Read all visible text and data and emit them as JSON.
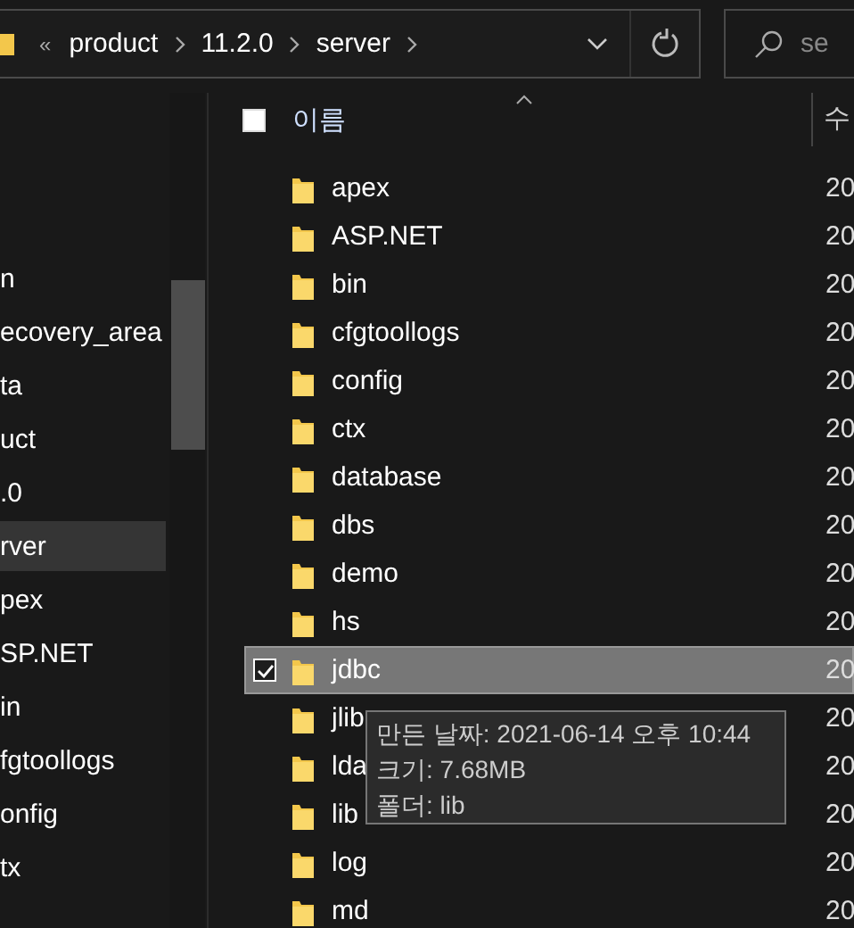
{
  "address_bar": {
    "overflow": "«",
    "crumbs": [
      "product",
      "11.2.0",
      "server"
    ]
  },
  "search": {
    "placeholder": "se"
  },
  "nav_pane": {
    "items": [
      {
        "label": "n",
        "selected": false
      },
      {
        "label": "ecovery_area",
        "selected": false
      },
      {
        "label": "ta",
        "selected": false
      },
      {
        "label": "uct",
        "selected": false
      },
      {
        "label": ".0",
        "selected": false
      },
      {
        "label": "rver",
        "selected": true
      },
      {
        "label": "pex",
        "selected": false
      },
      {
        "label": "SP.NET",
        "selected": false
      },
      {
        "label": "in",
        "selected": false
      },
      {
        "label": "fgtoollogs",
        "selected": false
      },
      {
        "label": "onfig",
        "selected": false
      },
      {
        "label": "tx",
        "selected": false
      }
    ]
  },
  "file_list": {
    "columns": [
      "이름",
      "수"
    ],
    "select_all_checked": false,
    "rows": [
      {
        "name": "apex",
        "column_2": "20",
        "selected": false
      },
      {
        "name": "ASP.NET",
        "column_2": "20",
        "selected": false
      },
      {
        "name": "bin",
        "column_2": "20",
        "selected": false
      },
      {
        "name": "cfgtoollogs",
        "column_2": "20",
        "selected": false
      },
      {
        "name": "config",
        "column_2": "20",
        "selected": false
      },
      {
        "name": "ctx",
        "column_2": "20",
        "selected": false
      },
      {
        "name": "database",
        "column_2": "20",
        "selected": false
      },
      {
        "name": "dbs",
        "column_2": "20",
        "selected": false
      },
      {
        "name": "demo",
        "column_2": "20",
        "selected": false
      },
      {
        "name": "hs",
        "column_2": "20",
        "selected": false
      },
      {
        "name": "jdbc",
        "column_2": "20",
        "selected": true
      },
      {
        "name": "jlib",
        "column_2": "20",
        "selected": false
      },
      {
        "name": "lda",
        "column_2": "20",
        "selected": false
      },
      {
        "name": "lib",
        "column_2": "20",
        "selected": false
      },
      {
        "name": "log",
        "column_2": "20",
        "selected": false
      },
      {
        "name": "md",
        "column_2": "20",
        "selected": false
      }
    ]
  },
  "tooltip": {
    "lines": [
      "만든 날짜: 2021-06-14 오후 10:44",
      "크기: 7.68MB",
      "폴더: lib"
    ]
  }
}
